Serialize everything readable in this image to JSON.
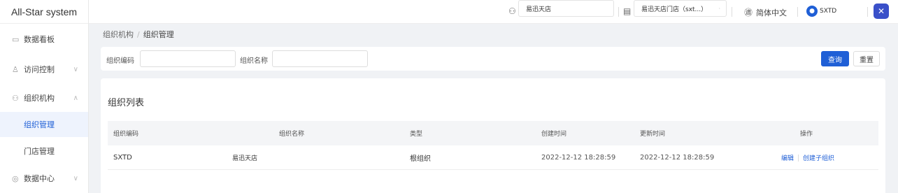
{
  "app": {
    "title": "All-Star system"
  },
  "sidebar": {
    "items": [
      {
        "label": "数据看板",
        "icon": "dashboard-icon"
      },
      {
        "label": "访问控制",
        "icon": "user-icon"
      },
      {
        "label": "组织机构",
        "icon": "org-icon"
      },
      {
        "label": "组织管理"
      },
      {
        "label": "门店管理"
      },
      {
        "label": "数据中心",
        "icon": "data-center-icon"
      }
    ]
  },
  "header": {
    "org_value": "易迅天店",
    "store_value": "易迅天店门店（sxt...）",
    "language": "简体中文",
    "user": "SXTD"
  },
  "breadcrumb": {
    "parent": "组织机构",
    "separator": "/",
    "current": "组织管理"
  },
  "search": {
    "code_label": "组织编码",
    "name_label": "组织名称",
    "code_value": "",
    "name_value": "",
    "query_label": "查询",
    "reset_label": "重置"
  },
  "list": {
    "title": "组织列表",
    "columns": [
      "组织编码",
      "组织名称",
      "类型",
      "创建时间",
      "更新时间",
      "操作"
    ],
    "rows": [
      {
        "code": "SXTD",
        "name": "易迅天店",
        "type": "根组织",
        "created": "2022-12-12 18:28:59",
        "updated": "2022-12-12 18:28:59",
        "action_edit": "编辑",
        "action_create_child": "创建子组织"
      }
    ]
  },
  "colors": {
    "primary": "#1f5fd6",
    "background": "#f0f2f5"
  }
}
